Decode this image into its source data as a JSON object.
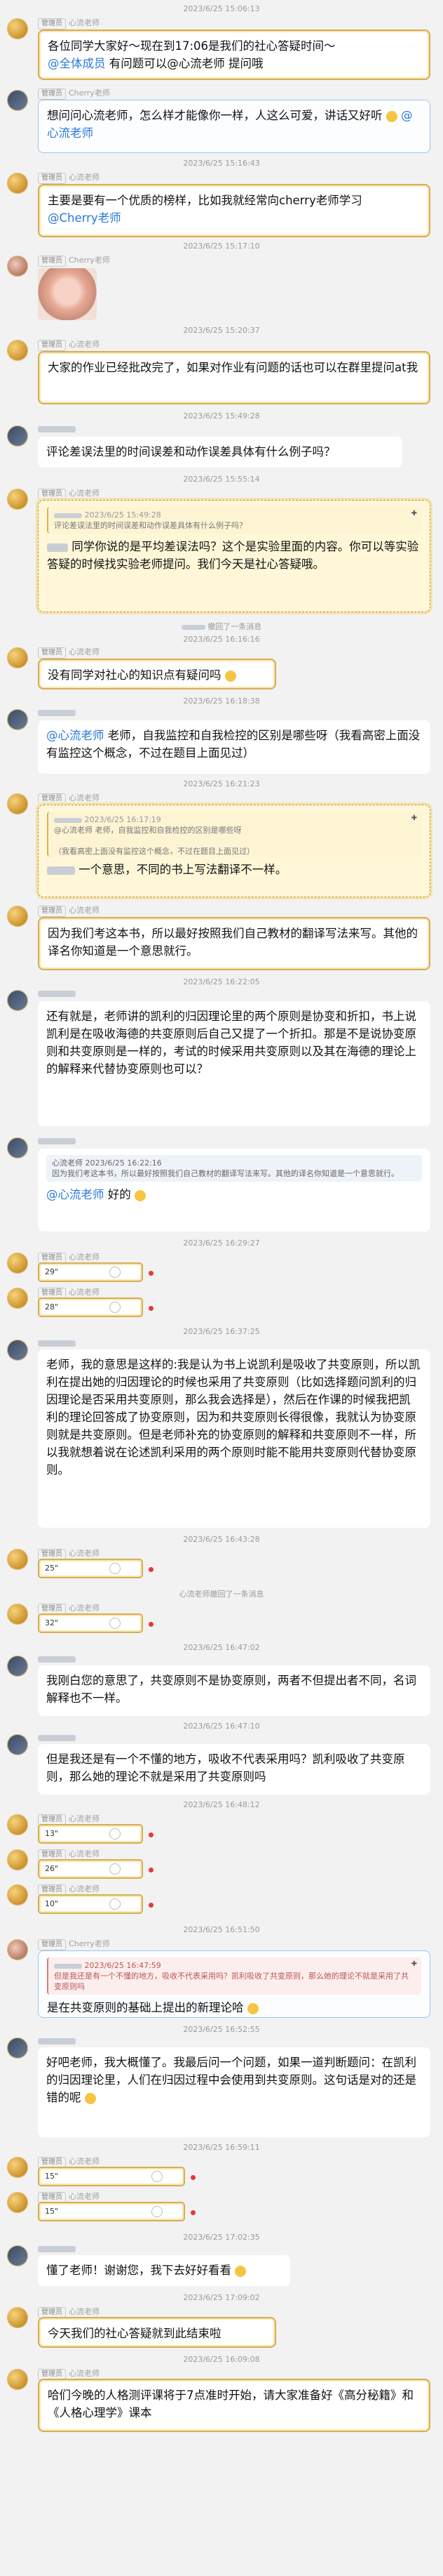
{
  "badge": "管理员",
  "teacher_name": "心流老师",
  "cherry_name": "Cherry老师",
  "messages": {
    "t1": "2023/6/25 15:06:13",
    "m1": "各位同学大家好～现在到17:06是我们的社心答疑时间～",
    "m1_at": "@全体成员",
    "m1_tail": "有问题可以@心流老师 提问哦",
    "m2": "想问问心流老师，怎么样才能像你一样，人这么可爱，讲话又好听",
    "m2_at": "@心流老师",
    "t2": "2023/6/25 15:16:43",
    "m3": "主要是要有一个优质的榜样，比如我就经常向cherry老师学习",
    "m3_at": "@Cherry老师",
    "t3": "2023/6/25 15:17:10",
    "t4": "2023/6/25 15:20:37",
    "m4": "大家的作业已经批改完了，如果对作业有问题的话也可以在群里提问at我",
    "t5": "2023/6/25 15:49:28",
    "m5": "评论差误法里的时间误差和动作误差具体有什么例子吗？",
    "t6": "2023/6/25 15:55:14",
    "q6_head": "2023/6/25 15:49:28",
    "q6_body": "评论差误法里的时间误差和动作误差具体有什么例子吗？",
    "m6": "同学你说的是平均差误法吗？这个是实验里面的内容。你可以等实验答疑的时候找实验老师提问。我们今天是社心答疑哦。",
    "sys1": "撤回了一条消息",
    "t7": "2023/6/25 16:16:16",
    "m7": "没有同学对社心的知识点有疑问吗",
    "t8": "2023/6/25 16:18:38",
    "m8_at": "@心流老师",
    "m8": "老师，自我监控和自我检控的区别是哪些呀（我看高密上面没有监控这个概念，不过在题目上面见过）",
    "t9": "2023/6/25 16:21:23",
    "q9_head": "2023/6/25 16:17:19",
    "q9_body": "@心流老师 老师，自我监控和自我检控的区别是哪些呀",
    "q9_body2": "（我看高密上面没有监控这个概念，不过在题目上面见过）",
    "m9": "一个意思，不同的书上写法翻译不一样。",
    "m10": "因为我们考这本书，所以最好按照我们自己教材的翻译写法来写。其他的译名你知道是一个意思就行。",
    "t10": "2023/6/25 16:22:05",
    "m11": "还有就是，老师讲的凯利的归因理论里的两个原则是协变和折扣，书上说凯利是在吸收海德的共变原则后自己又提了一个折扣。那是不是说协变原则和共变原则是一样的，考试的时候采用共变原则以及其在海德的理论上的解释来代替协变原则也可以？",
    "q12_head": "心流老师  2023/6/25 16:22:16",
    "q12_body": "因为我们考这本书，所以最好按照我们自己教材的翻译写法来写。其他的译名你知道是一个意思就行。",
    "m12_at": "@心流老师",
    "m12": "好的",
    "t11": "2023/6/25 16:29:27",
    "mini1": "29\"",
    "mini2": "28\"",
    "t12": "2023/6/25 16:37:25",
    "m13": "老师，我的意思是这样的:我是认为书上说凯利是吸收了共变原则，所以凯利在提出她的归因理论的时候也采用了共变原则（比如选择题问凯利的归因理论是否采用共变原则，那么我会选择是），然后在作课的时候我把凯利的理论回答成了协变原则，因为和共变原则长得很像，我就认为协变原则就是共变原则。但是老师补充的协变原则的解释和共变原则不一样，所以我就想着说在论述凯利采用的两个原则时能不能用共变原则代替协变原则。",
    "t13": "2023/6/25 16:43:28",
    "mini3": "25\"",
    "sys2": "心流老师撤回了一条消息",
    "mini4": "32\"",
    "t14": "2023/6/25 16:47:02",
    "m14": "我刚白您的意思了，共变原则不是协变原则，两者不但提出者不同，名词解释也不一样。",
    "t15": "2023/6/25 16:47:10",
    "m15": "但是我还是有一个不懂的地方，吸收不代表采用吗？凯利吸收了共变原则，那么她的理论不就是采用了共变原则吗",
    "t16": "2023/6/25 16:48:12",
    "mini5": "13\"",
    "mini6": "26\"",
    "mini7": "10\"",
    "t17": "2023/6/25 16:51:50",
    "q18_head": "2023/6/25 16:47:59",
    "q18_body": "但是我还是有一个不懂的地方，吸收不代表采用吗？凯利吸收了共变原则，那么她的理论不就是采用了共变原则吗",
    "m18": "是在共变原则的基础上提出的新理论哈",
    "t18": "2023/6/25 16:52:55",
    "m19": "好吧老师，我大概懂了。我最后问一个问题，如果一道判断题问：在凯利的归因理论里，人们在归因过程中会使用到共变原则。这句话是对的还是错的呢",
    "t19": "2023/6/25 16:59:11",
    "mini8": "15\"",
    "mini9": "15\"",
    "t20": "2023/6/25 17:02:35",
    "m20": "懂了老师！谢谢您，我下去好好看看",
    "t21": "2023/6/25 17:09:02",
    "m21": "今天我们的社心答疑就到此结束啦",
    "t22": "2023/6/25 16:09:08",
    "m22": "哈们今晚的人格测评课将于7点准时开始，请大家准备好《高分秘籍》和《人格心理学》课本"
  }
}
